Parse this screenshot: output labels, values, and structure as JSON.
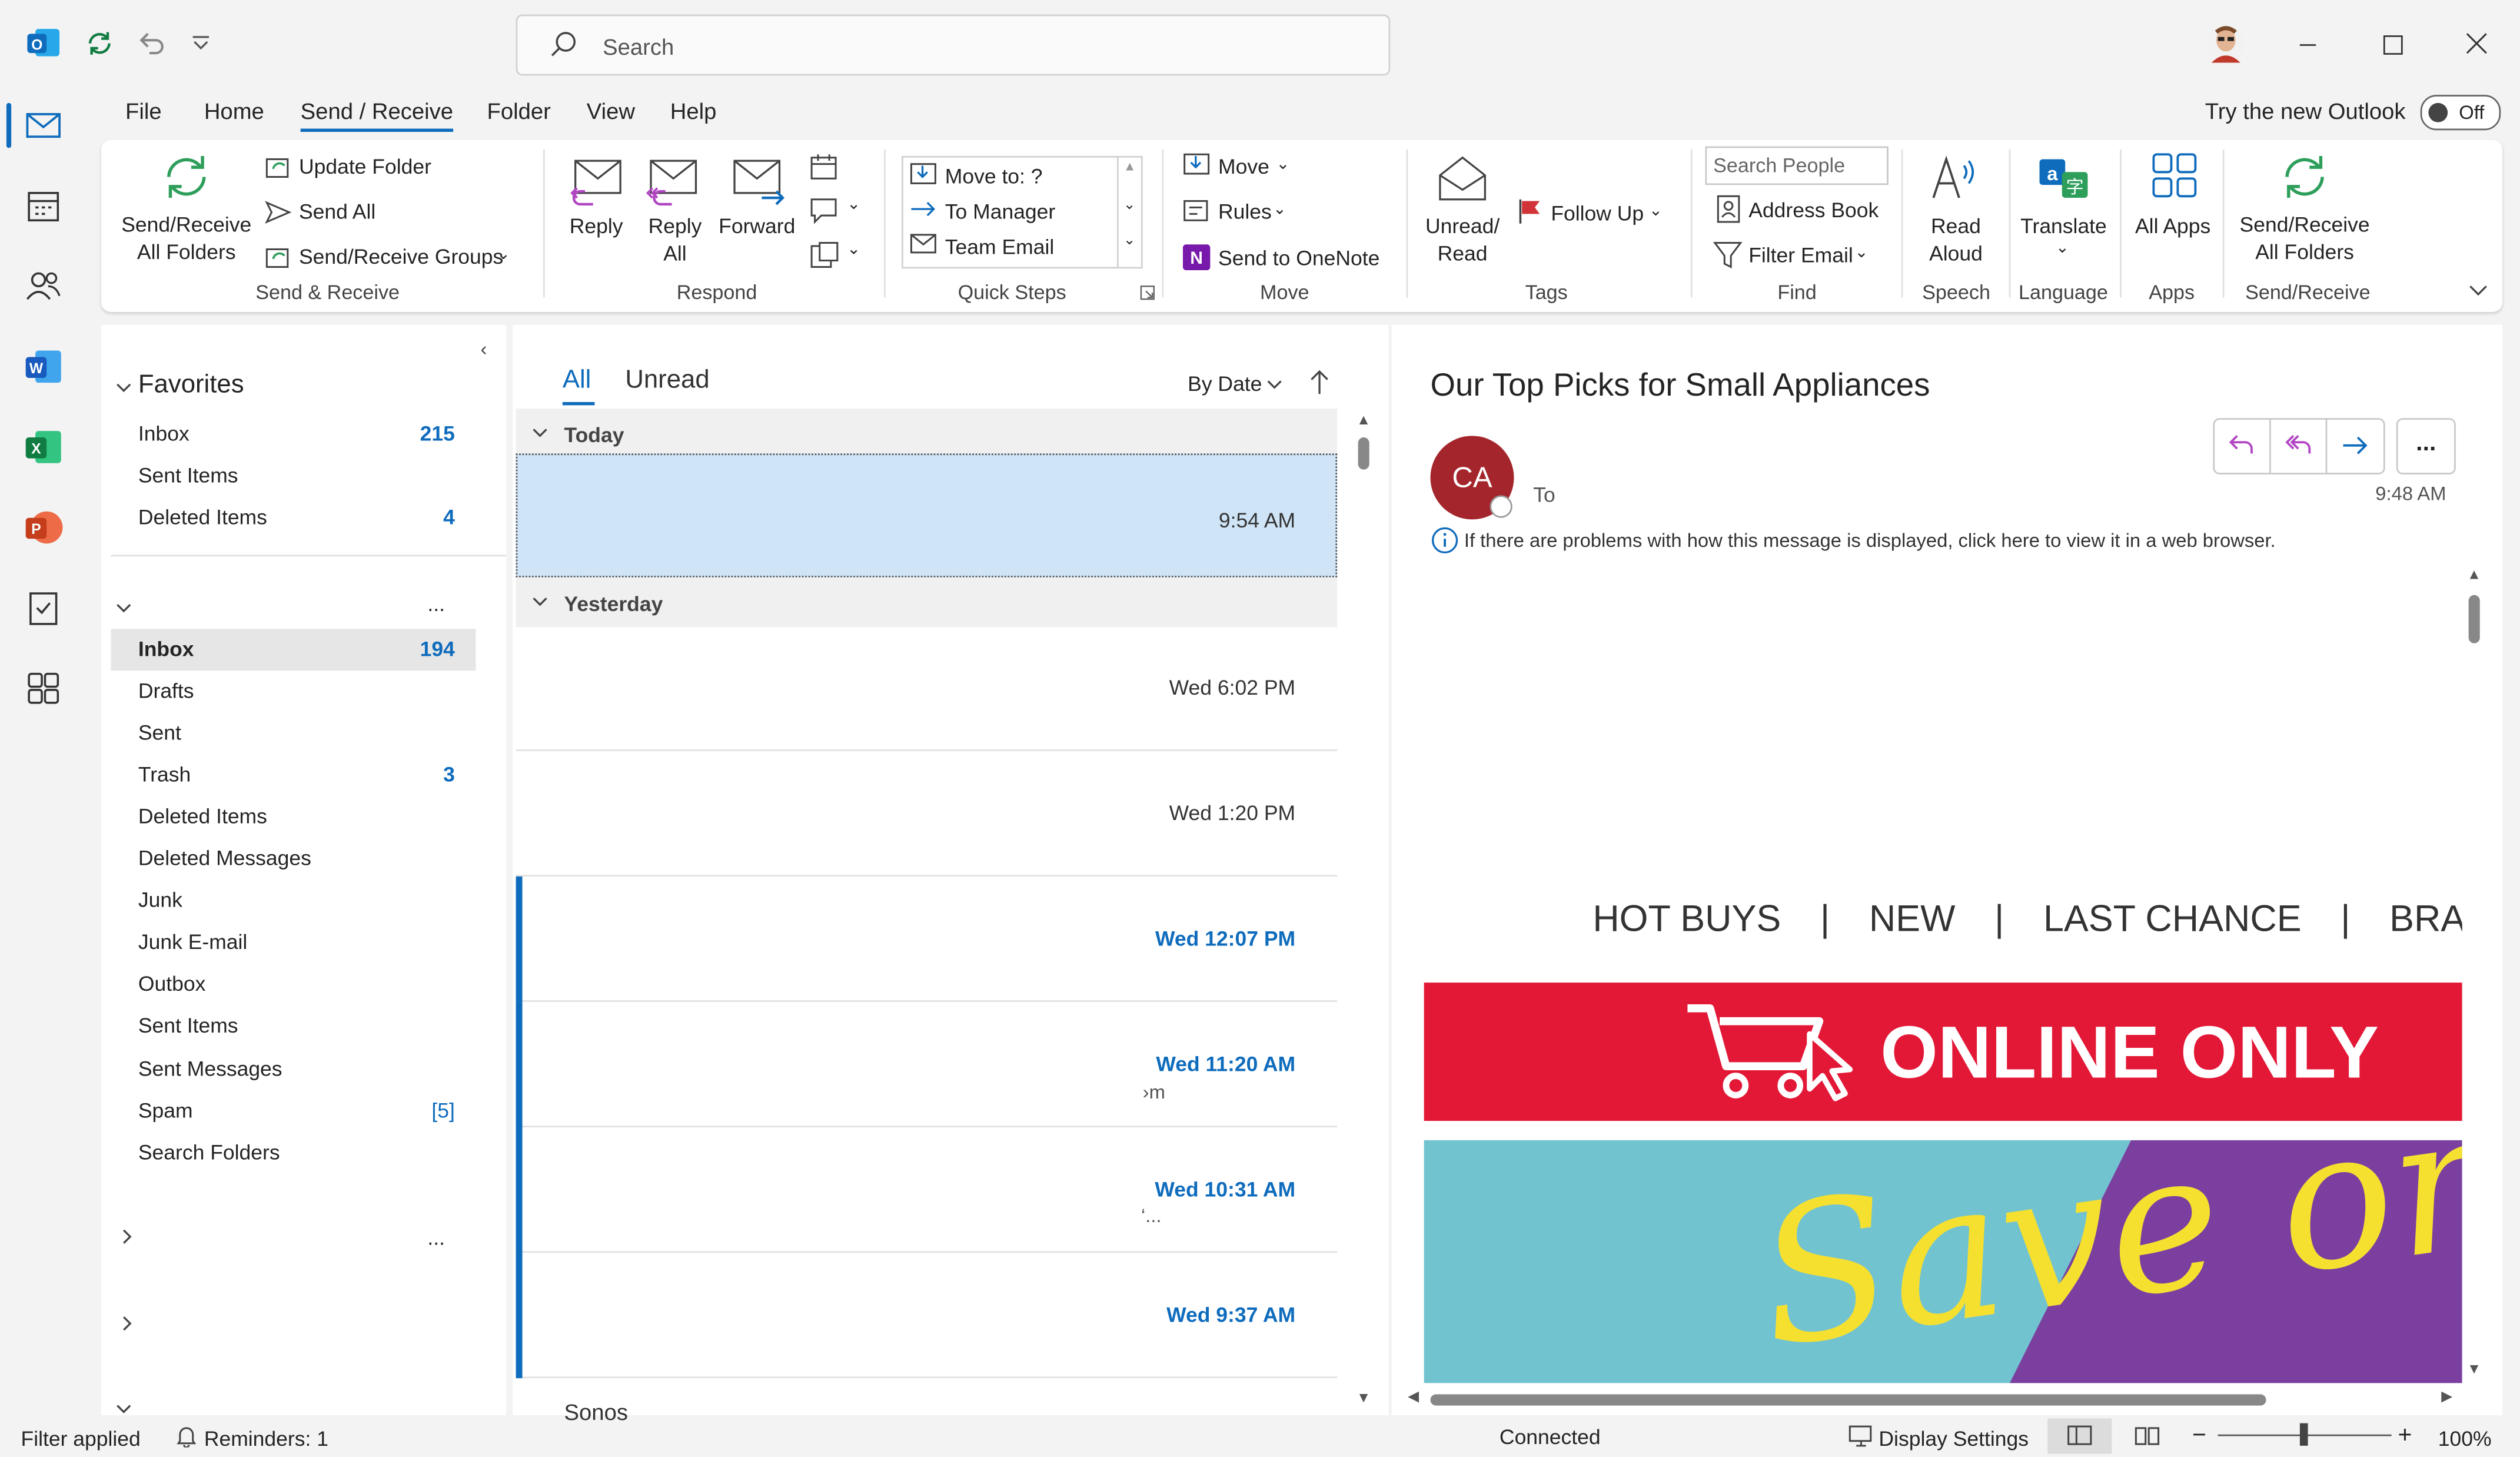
{
  "titlebar": {
    "search_placeholder": "Search"
  },
  "menu": {
    "tabs": [
      "File",
      "Home",
      "Send / Receive",
      "Folder",
      "View",
      "Help"
    ],
    "active_tab": "Send / Receive",
    "try_new_label": "Try the new Outlook",
    "toggle_state": "Off"
  },
  "ribbon": {
    "sendreceive_all": "Send/Receive All Folders",
    "update_folder": "Update Folder",
    "send_all": "Send All",
    "sr_groups": "Send/Receive Groups",
    "group_send_receive": "Send & Receive",
    "reply": "Reply",
    "reply_all": "Reply All",
    "forward": "Forward",
    "group_respond": "Respond",
    "qs_move_to": "Move to: ?",
    "qs_to_manager": "To Manager",
    "qs_team_email": "Team Email",
    "group_quick_steps": "Quick Steps",
    "move": "Move",
    "rules": "Rules",
    "send_onenote": "Send to OneNote",
    "group_move": "Move",
    "unread_read": "Unread/ Read",
    "follow_up": "Follow Up",
    "group_tags": "Tags",
    "search_people": "Search People",
    "address_book": "Address Book",
    "filter_email": "Filter Email",
    "group_find": "Find",
    "read_aloud": "Read Aloud",
    "group_speech": "Speech",
    "translate": "Translate",
    "group_language": "Language",
    "all_apps": "All Apps",
    "group_apps": "Apps",
    "sendreceive_all2": "Send/Receive All Folders",
    "group_send_receive2": "Send/Receive"
  },
  "folders": {
    "favorites_label": "Favorites",
    "favorites": [
      {
        "name": "Inbox",
        "count": "215"
      },
      {
        "name": "Sent Items",
        "count": ""
      },
      {
        "name": "Deleted Items",
        "count": "4"
      }
    ],
    "account_more": "...",
    "account": [
      {
        "name": "Inbox",
        "count": "194"
      },
      {
        "name": "Drafts",
        "count": ""
      },
      {
        "name": "Sent",
        "count": ""
      },
      {
        "name": "Trash",
        "count": "3"
      },
      {
        "name": "Deleted Items",
        "count": ""
      },
      {
        "name": "Deleted Messages",
        "count": ""
      },
      {
        "name": "Junk",
        "count": ""
      },
      {
        "name": "Junk E-mail",
        "count": ""
      },
      {
        "name": "Outbox",
        "count": ""
      },
      {
        "name": "Sent Items",
        "count": ""
      },
      {
        "name": "Sent Messages",
        "count": ""
      },
      {
        "name": "Spam",
        "count": "[5]"
      },
      {
        "name": "Search Folders",
        "count": ""
      }
    ],
    "more2": "...",
    "more3": "..."
  },
  "message_list": {
    "filter_all": "All",
    "filter_unread": "Unread",
    "sort_label": "By Date",
    "groups": [
      "Today",
      "Yesterday"
    ],
    "messages": [
      {
        "time": "9:54 AM",
        "unread": false,
        "selected": true,
        "preview": ""
      },
      {
        "time": "Wed 6:02 PM",
        "unread": false,
        "selected": false,
        "preview": ""
      },
      {
        "time": "Wed 1:20 PM",
        "unread": false,
        "selected": false,
        "preview": ""
      },
      {
        "time": "Wed 12:07 PM",
        "unread": true,
        "selected": false,
        "preview": ""
      },
      {
        "time": "Wed 11:20 AM",
        "unread": true,
        "selected": false,
        "preview": "›m"
      },
      {
        "time": "Wed 10:31 AM",
        "unread": true,
        "selected": false,
        "preview": "‘..."
      },
      {
        "time": "Wed 9:37 AM",
        "unread": true,
        "selected": false,
        "preview": ""
      }
    ],
    "partial_sender": "Sonos"
  },
  "reading_pane": {
    "subject": "Our Top Picks for Small Appliances",
    "avatar_initials": "CA",
    "avatar_color": "#a4262c",
    "to_label": "To",
    "time": "9:48 AM",
    "info_text": "If there are problems with how this message is displayed, click here to view it in a web browser.",
    "nav_links": [
      "HOT BUYS",
      "|",
      "NEW",
      "|",
      "LAST CHANCE",
      "|",
      "BRANDS"
    ],
    "banner_text": "ONLINE ONLY",
    "banner_color": "#e31837",
    "promo_text": "Save on",
    "promo_colors": {
      "teal": "#72c3d0",
      "purple": "#7b3fa0",
      "yellow": "#f5e030"
    },
    "more_label": "..."
  },
  "statusbar": {
    "filter": "Filter applied",
    "reminders": "Reminders: 1",
    "connection": "Connected",
    "display_settings": "Display Settings",
    "zoom": "100%"
  },
  "colors": {
    "accent": "#0f6cbd",
    "selected_row": "#cfe4f7"
  }
}
